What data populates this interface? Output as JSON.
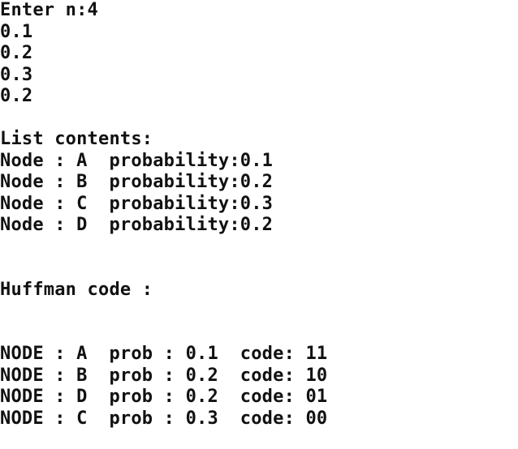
{
  "console": {
    "prompt": "Enter n:4",
    "inputs": [
      "0.1",
      "0.2",
      "0.3",
      "0.2"
    ],
    "list_header": "List contents:",
    "list_rows": [
      "Node : A  probability:0.1",
      "Node : B  probability:0.2",
      "Node : C  probability:0.3",
      "Node : D  probability:0.2"
    ],
    "huffman_header": "Huffman code :",
    "code_rows": [
      "NODE : A  prob : 0.1  code: 11",
      "NODE : B  prob : 0.2  code: 10",
      "NODE : D  prob : 0.2  code: 01",
      "NODE : C  prob : 0.3  code: 00"
    ]
  }
}
